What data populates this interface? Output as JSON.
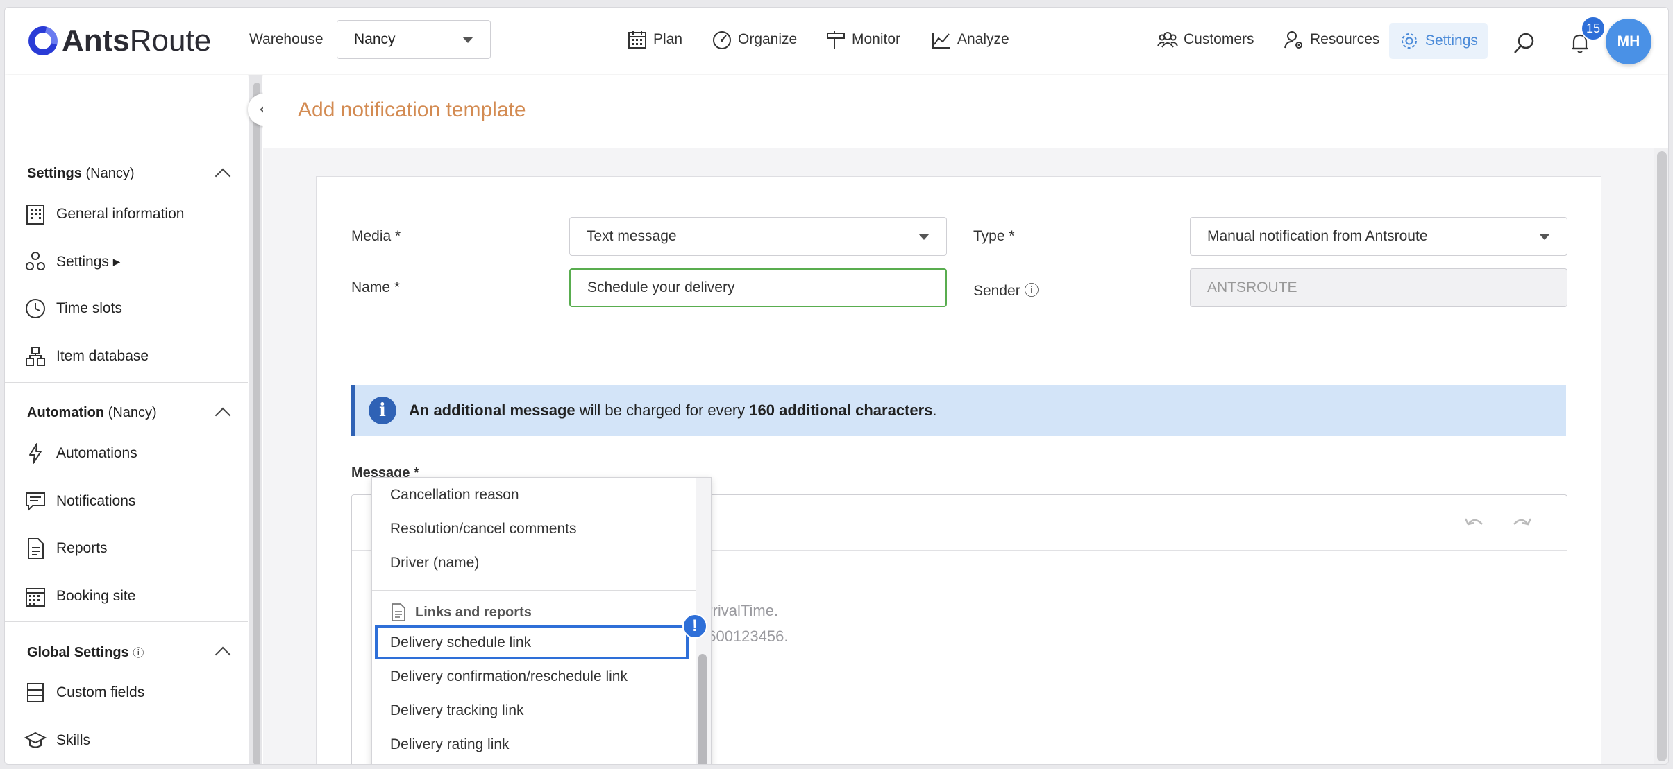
{
  "app": {
    "logo_bold": "Ants",
    "logo_light": "Route"
  },
  "header": {
    "warehouse_label": "Warehouse",
    "warehouse_value": "Nancy",
    "nav": [
      {
        "label": "Plan",
        "icon": "calendar-icon"
      },
      {
        "label": "Organize",
        "icon": "gauge-icon"
      },
      {
        "label": "Monitor",
        "icon": "signpost-icon"
      },
      {
        "label": "Analyze",
        "icon": "chart-icon"
      }
    ],
    "right_nav": [
      {
        "label": "Customers",
        "icon": "customers-icon"
      },
      {
        "label": "Resources",
        "icon": "resources-icon"
      },
      {
        "label": "Settings",
        "icon": "gear-icon"
      }
    ],
    "notification_count": "15",
    "avatar_initials": "MH"
  },
  "sidebar": {
    "sections": [
      {
        "title": "Settings",
        "suffix": "(Nancy)"
      },
      {
        "title": "Automation",
        "suffix": "(Nancy)"
      },
      {
        "title": "Global Settings",
        "suffix": "ⓘ"
      }
    ],
    "settings_items": [
      {
        "label": "General information",
        "icon": "building-icon"
      },
      {
        "label": "Settings ▸",
        "icon": "cogs-icon"
      },
      {
        "label": "Time slots",
        "icon": "clock-icon"
      },
      {
        "label": "Item database",
        "icon": "boxes-icon"
      }
    ],
    "automation_items": [
      {
        "label": "Automations",
        "icon": "bolt-icon"
      },
      {
        "label": "Notifications",
        "icon": "message-icon"
      },
      {
        "label": "Reports",
        "icon": "report-icon"
      },
      {
        "label": "Booking site",
        "icon": "calendar-grid-icon"
      }
    ],
    "global_items": [
      {
        "label": "Custom fields",
        "icon": "fields-icon"
      },
      {
        "label": "Skills",
        "icon": "graduation-cap-icon"
      }
    ]
  },
  "page": {
    "title": "Add notification template",
    "form": {
      "media_label": "Media *",
      "media_value": "Text message",
      "type_label": "Type *",
      "type_value": "Manual notification from Antsroute",
      "name_label": "Name *",
      "name_value": "Schedule your delivery",
      "sender_label": "Sender ⓘ",
      "sender_value": "ANTSROUTE"
    },
    "info": {
      "bold1": "An additional message",
      "text1": " will be charged for every ",
      "bold2": "160 additional characters",
      "text2": "."
    },
    "message_label": "Message *",
    "editor_text": [
      "arrivalTime.",
      "7600123456."
    ],
    "dropdown": {
      "items_top": [
        "Cancellation reason",
        "Resolution/cancel comments",
        "Driver (name)"
      ],
      "group": "Links and reports",
      "items_links": [
        "Delivery schedule link",
        "Delivery confirmation/reschedule link",
        "Delivery tracking link",
        "Delivery rating link"
      ],
      "selected": "Delivery schedule link",
      "alert": "!"
    }
  }
}
